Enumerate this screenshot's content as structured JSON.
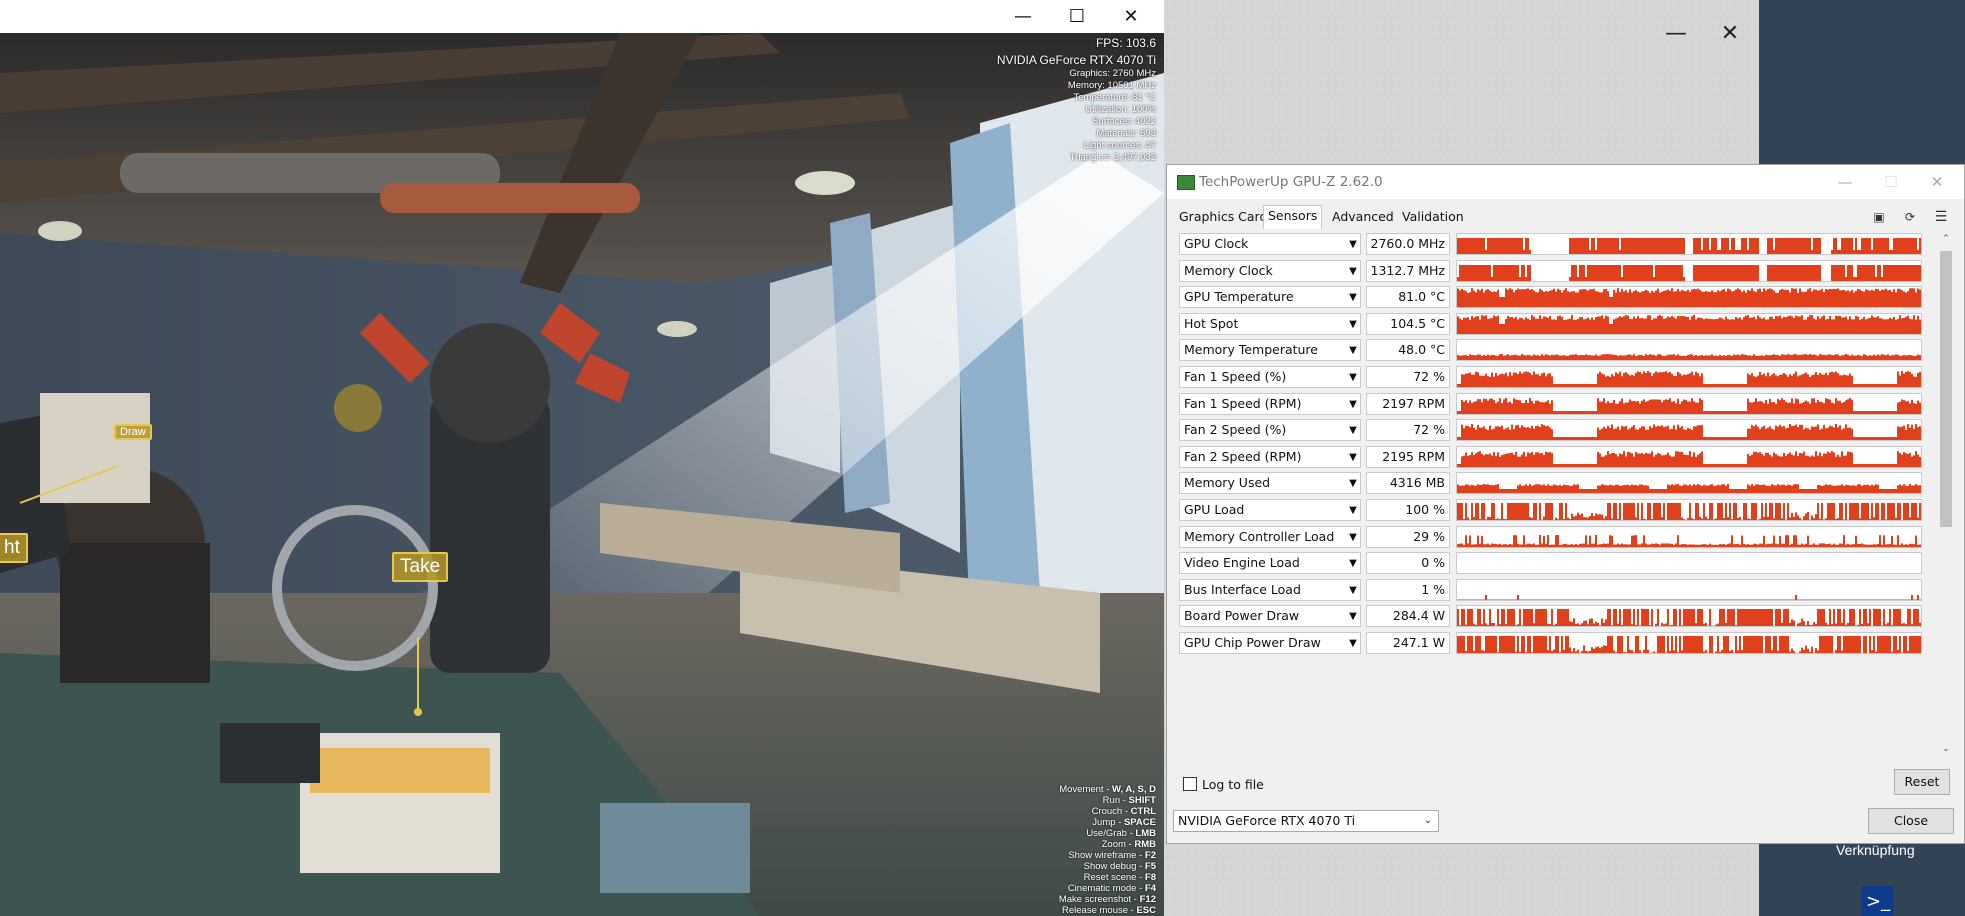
{
  "game": {
    "window_controls": {
      "minimize": "—",
      "maximize": "☐",
      "close": "✕"
    },
    "hud": {
      "fps": "FPS: 103.6",
      "gpu": "NVIDIA GeForce RTX 4070 Ti",
      "stats": [
        "Graphics: 2760 MHz",
        "Memory: 10501 MHz",
        "Temperature: 81 °C",
        "Utilization: 100%",
        "Surfaces: 4022",
        "Materials: 593",
        "Light sources: 47",
        "Triangles: 3,497,032"
      ],
      "help": [
        {
          "action": "Movement - ",
          "key": "W, A, S, D"
        },
        {
          "action": "Run - ",
          "key": "SHIFT"
        },
        {
          "action": "Crouch - ",
          "key": "CTRL"
        },
        {
          "action": "Jump - ",
          "key": "SPACE"
        },
        {
          "action": "Use/Grab - ",
          "key": "LMB"
        },
        {
          "action": "Zoom - ",
          "key": "RMB"
        },
        {
          "action": "Show wireframe - ",
          "key": "F2"
        },
        {
          "action": "Show debug - ",
          "key": "F5"
        },
        {
          "action": "Reset scene - ",
          "key": "F8"
        },
        {
          "action": "Cinematic mode - ",
          "key": "F4"
        },
        {
          "action": "Make screenshot - ",
          "key": "F12"
        },
        {
          "action": "Release mouse - ",
          "key": "ESC"
        }
      ]
    },
    "hints": {
      "take": "Take",
      "draw": "Draw",
      "light": "ht"
    }
  },
  "back_window": {
    "minimize": "—",
    "close": "✕"
  },
  "desktop": {
    "shortcut_label": "Verknüpfung",
    "ps_icon": ">_"
  },
  "gpuz": {
    "title": "TechPowerUp GPU-Z 2.62.0",
    "title_controls": {
      "minimize": "—",
      "maximize": "☐",
      "close": "✕"
    },
    "tabs": [
      "Graphics Card",
      "Sensors",
      "Advanced",
      "Validation"
    ],
    "active_tab": "Sensors",
    "toolbar_icons": [
      "camera-icon",
      "refresh-icon",
      "menu-icon"
    ],
    "accent_color": "#e0401c",
    "sensors": [
      {
        "name": "GPU Clock",
        "value": "2760.0 MHz"
      },
      {
        "name": "Memory Clock",
        "value": "1312.7 MHz"
      },
      {
        "name": "GPU Temperature",
        "value": "81.0 °C"
      },
      {
        "name": "Hot Spot",
        "value": "104.5 °C"
      },
      {
        "name": "Memory Temperature",
        "value": "48.0 °C"
      },
      {
        "name": "Fan 1 Speed (%)",
        "value": "72 %"
      },
      {
        "name": "Fan 1 Speed (RPM)",
        "value": "2197 RPM"
      },
      {
        "name": "Fan 2 Speed (%)",
        "value": "72 %"
      },
      {
        "name": "Fan 2 Speed (RPM)",
        "value": "2195 RPM"
      },
      {
        "name": "Memory Used",
        "value": "4316 MB"
      },
      {
        "name": "GPU Load",
        "value": "100 %"
      },
      {
        "name": "Memory Controller Load",
        "value": "29 %"
      },
      {
        "name": "Video Engine Load",
        "value": "0 %"
      },
      {
        "name": "Bus Interface Load",
        "value": "1 %"
      },
      {
        "name": "Board Power Draw",
        "value": "284.4 W"
      },
      {
        "name": "GPU Chip Power Draw",
        "value": "247.1 W"
      }
    ],
    "log_to_file": "Log to file",
    "reset": "Reset",
    "gpu_select": "NVIDIA GeForce RTX 4070 Ti",
    "close": "Close"
  }
}
